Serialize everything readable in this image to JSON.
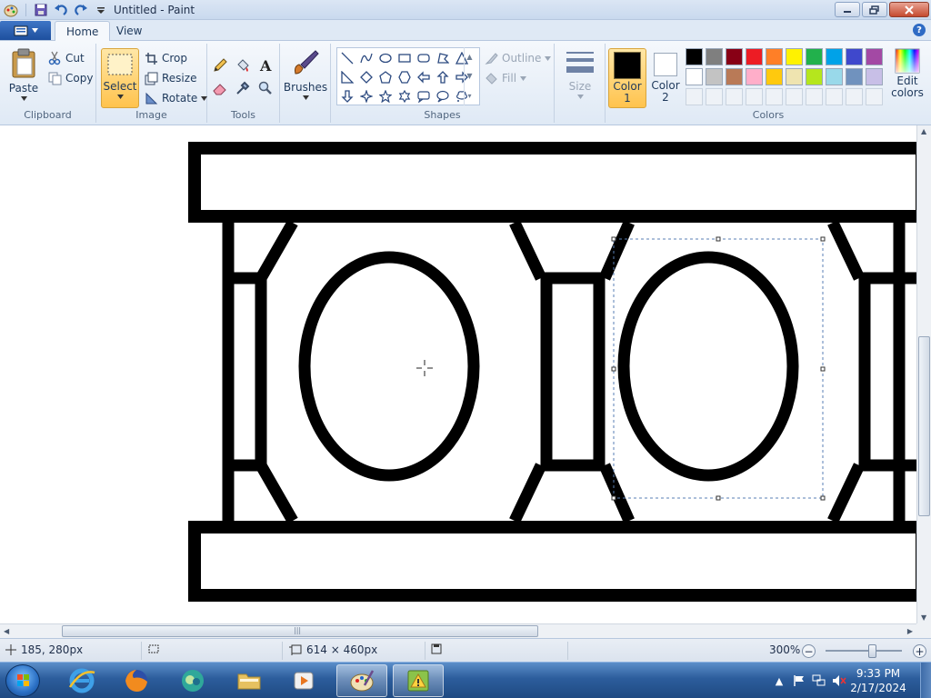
{
  "window": {
    "title": "Untitled - Paint"
  },
  "qat": {
    "icons": [
      "paint-app-icon",
      "save-icon",
      "undo-icon",
      "redo-icon",
      "customize-qat-icon"
    ]
  },
  "tabs": {
    "home": "Home",
    "view": "View"
  },
  "ribbon": {
    "clipboard": {
      "label": "Clipboard",
      "paste": "Paste",
      "cut": "Cut",
      "copy": "Copy"
    },
    "image": {
      "label": "Image",
      "select": "Select",
      "crop": "Crop",
      "resize": "Resize",
      "rotate": "Rotate"
    },
    "tools": {
      "label": "Tools",
      "items": [
        "pencil-icon",
        "fill-icon",
        "text-icon",
        "eraser-icon",
        "color-picker-icon",
        "magnifier-icon"
      ]
    },
    "brushes": {
      "label": "Brushes"
    },
    "shapes": {
      "label": "Shapes",
      "outline": "Outline",
      "fill": "Fill",
      "items": [
        "line",
        "curve",
        "oval",
        "rectangle",
        "rounded-rectangle",
        "polygon",
        "triangle",
        "right-triangle",
        "diamond",
        "pentagon",
        "hexagon",
        "left-arrow",
        "up-arrow",
        "right-arrow",
        "down-arrow",
        "four-point-star",
        "five-point-star",
        "six-point-star",
        "rounded-callout",
        "oval-callout",
        "cloud-callout"
      ]
    },
    "size": {
      "label": "Size"
    },
    "colors": {
      "label": "Colors",
      "color1_label": "Color",
      "color1_num": "1",
      "color2_label": "Color",
      "color2_num": "2",
      "color1": "#000000",
      "color2": "#ffffff",
      "edit_label_line1": "Edit",
      "edit_label_line2": "colors",
      "palette_row1": [
        "#000000",
        "#7f7f7f",
        "#880015",
        "#ed1c24",
        "#ff7f27",
        "#fff200",
        "#22b14c",
        "#00a2e8",
        "#3f48cc",
        "#a349a4"
      ],
      "palette_row2": [
        "#ffffff",
        "#c3c3c3",
        "#b97a57",
        "#ffaec9",
        "#ffc90e",
        "#efe4b0",
        "#b5e61d",
        "#99d9ea",
        "#7092be",
        "#c8bfe7"
      ]
    }
  },
  "status": {
    "cursor_pos": "185, 280px",
    "image_size": "614 × 460px",
    "zoom": "300%"
  },
  "taskbar": {
    "time": "9:33 PM",
    "date": "2/17/2024"
  }
}
